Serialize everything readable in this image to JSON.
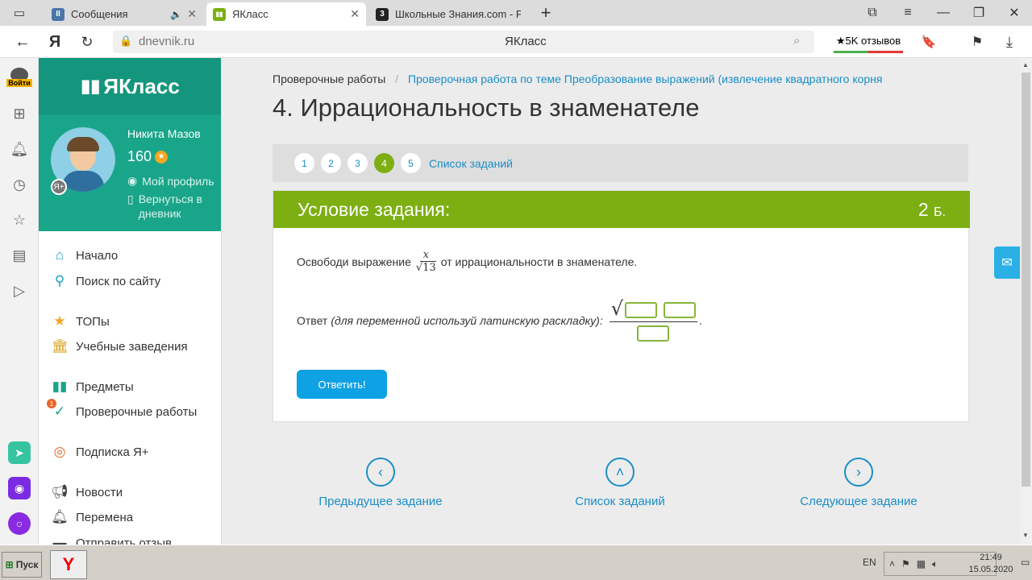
{
  "browser": {
    "tabs": [
      {
        "title": "Сообщения",
        "favicon_color": "#4a76a8",
        "favicon_glyph": "II"
      },
      {
        "title": "ЯКласс",
        "favicon_color": "#7daf12",
        "favicon_glyph": "▮▮",
        "active": true
      },
      {
        "title": "Школьные Знания.com - Р",
        "favicon_color": "#222222",
        "favicon_glyph": "3"
      }
    ],
    "url_domain": "dnevnik.ru",
    "page_title": "ЯКласс",
    "reviews_label": "★5K отзывов",
    "login_label": "Войти"
  },
  "site": {
    "logo": "ЯКласс",
    "user_name": "Никита Мазов",
    "points": "160",
    "my_profile": "Мой профиль",
    "back_to_diary": "Вернуться в дневник",
    "nav": [
      {
        "label": "Начало",
        "icon": "home-icon"
      },
      {
        "label": "Поиск по сайту",
        "icon": "search-icon"
      },
      {
        "label": "ТОПы",
        "icon": "star-icon"
      },
      {
        "label": "Учебные заведения",
        "icon": "institution-icon"
      },
      {
        "label": "Предметы",
        "icon": "book-icon"
      },
      {
        "label": "Проверочные работы",
        "icon": "check-icon",
        "badge": "1"
      },
      {
        "label": "Подписка Я+",
        "icon": "yaplus-icon"
      },
      {
        "label": "Новости",
        "icon": "megaphone-icon"
      },
      {
        "label": "Перемена",
        "icon": "bell-icon"
      },
      {
        "label": "Отправить отзыв",
        "icon": "feedback-icon"
      }
    ]
  },
  "main": {
    "breadcrumb_root": "Проверочные работы",
    "breadcrumb_sep": "/",
    "breadcrumb_current": "Проверочная работа по теме Преобразование выражений (извлечение квадратного корня",
    "title": "4. Иррациональность в знаменателе",
    "steps": [
      "1",
      "2",
      "3",
      "4",
      "5"
    ],
    "current_step": "4",
    "task_list_link": "Список заданий",
    "condition_title": "Условие задания:",
    "points_value": "2",
    "points_unit": "Б.",
    "task_text_before": "Освободи выражение",
    "fraction_num": "x",
    "fraction_den": "13",
    "task_text_after": "от иррациональности в знаменателе.",
    "answer_label": "Ответ",
    "answer_hint": "(для переменной используй латинскую раскладку):",
    "answer_button": "Ответить!",
    "prev_task": "Предыдущее задание",
    "list_tasks": "Список заданий",
    "next_task": "Следующее задание"
  },
  "taskbar": {
    "start": "Пуск",
    "lang": "EN",
    "time": "21:49",
    "date": "15.05.2020"
  },
  "colors": {
    "brand_green": "#19a58a",
    "task_green": "#7daf12",
    "link_blue": "#1a8ec6",
    "button_blue": "#0ea1e3"
  }
}
